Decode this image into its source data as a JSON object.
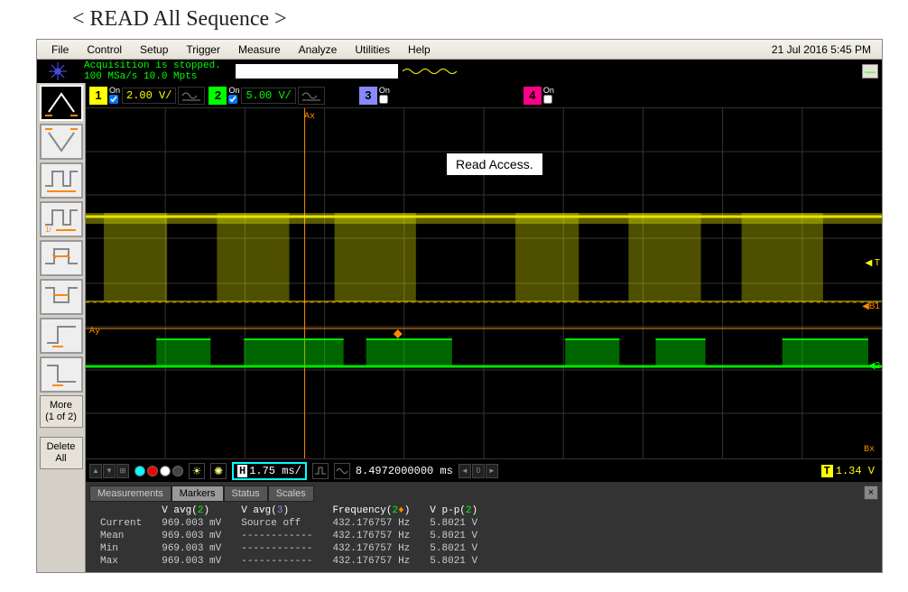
{
  "page_title": "< READ All Sequence >",
  "menubar": {
    "items": [
      "File",
      "Control",
      "Setup",
      "Trigger",
      "Measure",
      "Analyze",
      "Utilities",
      "Help"
    ],
    "date": "21 Jul 2016  5:45 PM"
  },
  "status": {
    "line1": "Acquisition is stopped.",
    "line2": "100 MSa/s    10.0 Mpts"
  },
  "channels": {
    "c1": {
      "num": "1",
      "on": "On",
      "val": "2.00 V/"
    },
    "c2": {
      "num": "2",
      "on": "On",
      "val": "5.00 V/"
    },
    "c3": {
      "num": "3",
      "on": "On"
    },
    "c4": {
      "num": "4",
      "on": "On"
    }
  },
  "waveform": {
    "label": "Read Access.",
    "ax": "Ax",
    "ay": "Ay",
    "bx": "Bx",
    "t": "T",
    "b1": "B1",
    "ch2mark": "2"
  },
  "timebase": {
    "h_label": "H",
    "h_val": "1.75 ms/",
    "delay": "8.4972000000 ms",
    "t_label": "T",
    "t_val": "1.34 V",
    "nav": {
      "prev": "◄",
      "zero": "0",
      "next": "►"
    }
  },
  "sidebar": {
    "more": {
      "l1": "More",
      "l2": "(1 of 2)"
    },
    "delete": {
      "l1": "Delete",
      "l2": "All"
    }
  },
  "meas": {
    "tabs": [
      "Measurements",
      "Markers",
      "Status",
      "Scales"
    ],
    "active_tab": 1,
    "headers": {
      "col1": "V avg(2)",
      "col2": "V avg(3)",
      "col3": "Frequency(2♦)",
      "col4": "V p-p(2)"
    },
    "rows": [
      {
        "label": "Current",
        "v1": "969.003 mV",
        "v2": "Source off",
        "v3": "432.176757 Hz",
        "v4": "5.8021 V"
      },
      {
        "label": "Mean",
        "v1": "969.003 mV",
        "v2": "------------",
        "v3": "432.176757 Hz",
        "v4": "5.8021 V"
      },
      {
        "label": "Min",
        "v1": "969.003 mV",
        "v2": "------------",
        "v3": "432.176757 Hz",
        "v4": "5.8021 V"
      },
      {
        "label": "Max",
        "v1": "969.003 mV",
        "v2": "------------",
        "v3": "432.176757 Hz",
        "v4": "5.8021 V"
      }
    ]
  },
  "colors": {
    "ch1": "#ffff00",
    "ch2": "#00ff00",
    "ch3": "#8888ff",
    "ch4": "#ff0088",
    "marker": "#ff8800",
    "cyan": "#00ffff"
  }
}
